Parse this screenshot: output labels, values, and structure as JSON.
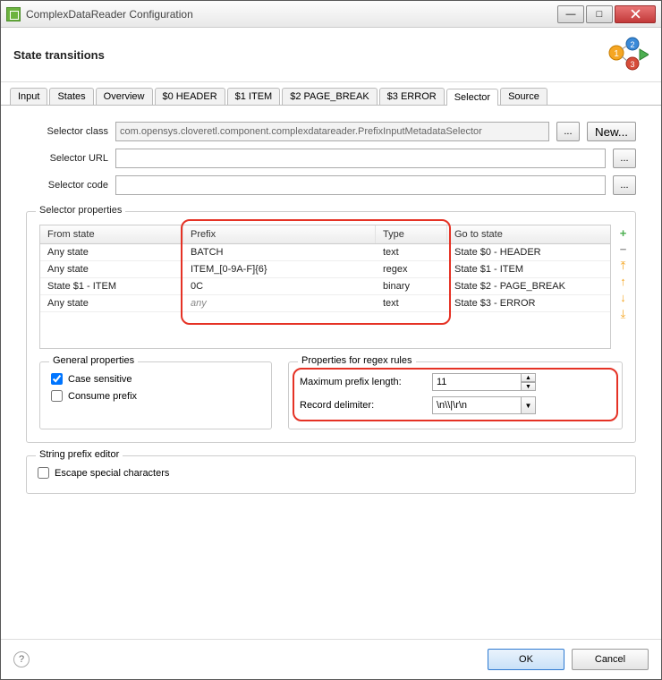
{
  "window": {
    "title": "ComplexDataReader Configuration"
  },
  "header": {
    "title": "State transitions"
  },
  "tabs": [
    "Input",
    "States",
    "Overview",
    "$0 HEADER",
    "$1 ITEM",
    "$2 PAGE_BREAK",
    "$3 ERROR",
    "Selector",
    "Source"
  ],
  "selected_tab": "Selector",
  "fields": {
    "selector_class_label": "Selector class",
    "selector_class_value": "com.opensys.cloveretl.component.complexdatareader.PrefixInputMetadataSelector",
    "selector_url_label": "Selector URL",
    "selector_url_value": "",
    "selector_code_label": "Selector code",
    "selector_code_value": "",
    "new_label": "New...",
    "ellipsis": "..."
  },
  "selector_props": {
    "title": "Selector properties",
    "columns": {
      "from": "From state",
      "prefix": "Prefix",
      "type": "Type",
      "goto": "Go to state"
    },
    "rows": [
      {
        "from": "Any state",
        "prefix": "BATCH",
        "type": "text",
        "goto": "State $0 - HEADER"
      },
      {
        "from": "Any state",
        "prefix": "ITEM_[0-9A-F]{6}",
        "type": "regex",
        "goto": "State $1 - ITEM"
      },
      {
        "from": "State $1 - ITEM",
        "prefix": "0C",
        "type": "binary",
        "goto": "State $2 - PAGE_BREAK"
      },
      {
        "from": "Any state",
        "prefix": "any",
        "type": "text",
        "goto": "State $3 - ERROR",
        "prefix_italic": true
      }
    ]
  },
  "general": {
    "title": "General properties",
    "case_sensitive_label": "Case sensitive",
    "case_sensitive": true,
    "consume_prefix_label": "Consume prefix",
    "consume_prefix": false
  },
  "regex_props": {
    "title": "Properties for regex rules",
    "max_prefix_label": "Maximum prefix length:",
    "max_prefix_value": "11",
    "record_delim_label": "Record delimiter:",
    "record_delim_value": "\\n\\\\|\\r\\n"
  },
  "string_editor": {
    "title": "String prefix editor",
    "escape_label": "Escape special characters",
    "escape": false
  },
  "footer": {
    "ok": "OK",
    "cancel": "Cancel",
    "help": "?"
  }
}
